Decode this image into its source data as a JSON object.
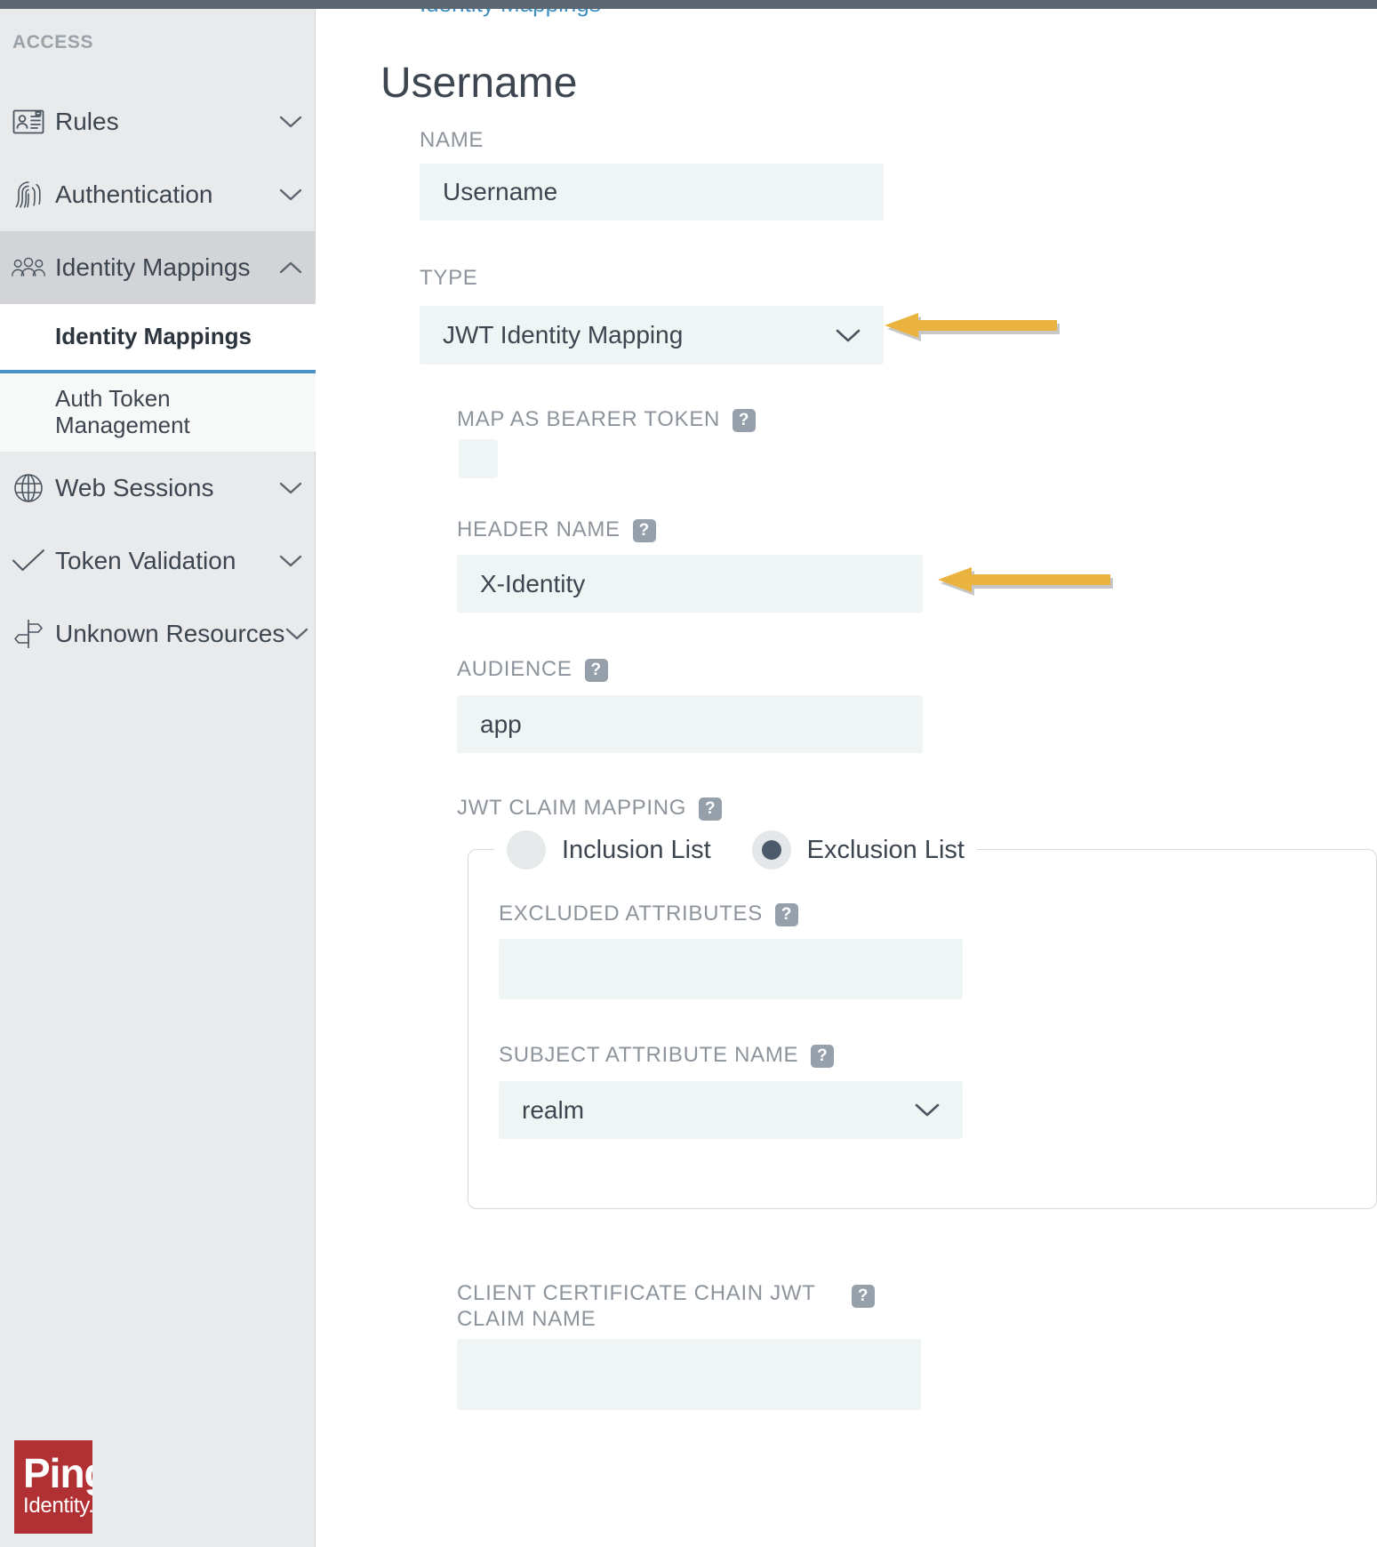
{
  "breadcrumb": {
    "text": "Identity Mappings"
  },
  "sidebar": {
    "section_title": "ACCESS",
    "items": [
      {
        "label": "Rules",
        "icon": "id-card-icon",
        "chevron": "chevron-down-icon",
        "expanded": false
      },
      {
        "label": "Authentication",
        "icon": "fingerprint-icon",
        "chevron": "chevron-down-icon",
        "expanded": false
      },
      {
        "label": "Identity Mappings",
        "icon": "users-group-icon",
        "chevron": "chevron-up-icon",
        "expanded": true
      },
      {
        "label": "Web Sessions",
        "icon": "globe-icon",
        "chevron": "chevron-down-icon",
        "expanded": false
      },
      {
        "label": "Token Validation",
        "icon": "check-icon",
        "chevron": "chevron-down-icon",
        "expanded": false
      },
      {
        "label": "Unknown Resources",
        "icon": "signpost-icon",
        "chevron": "chevron-down-icon",
        "expanded": false
      }
    ],
    "subitems": [
      {
        "label": "Identity Mappings",
        "active": true
      },
      {
        "label": "Auth Token Management",
        "active": false
      }
    ],
    "logo": {
      "line1": "Ping",
      "line2": "Identity."
    }
  },
  "main": {
    "page_title": "Username",
    "fields": {
      "name": {
        "label": "NAME",
        "value": "Username",
        "placeholder": ""
      },
      "type": {
        "label": "TYPE",
        "value": "JWT Identity Mapping",
        "chevron": "chevron-down-icon"
      },
      "map_as_bearer_token": {
        "label": "MAP AS BEARER TOKEN",
        "help": "?",
        "checked": false
      },
      "header_name": {
        "label": "HEADER NAME",
        "help": "?",
        "value": "X-Identity",
        "placeholder": ""
      },
      "audience": {
        "label": "AUDIENCE",
        "help": "?",
        "value": "app",
        "placeholder": ""
      },
      "jwt_claim_mapping": {
        "label": "JWT CLAIM MAPPING",
        "help": "?",
        "options": [
          {
            "label": "Inclusion List",
            "selected": false
          },
          {
            "label": "Exclusion List",
            "selected": true
          }
        ]
      },
      "excluded_attributes": {
        "label": "EXCLUDED ATTRIBUTES",
        "help": "?",
        "value": "",
        "placeholder": ""
      },
      "subject_attribute_name": {
        "label": "SUBJECT ATTRIBUTE NAME",
        "help": "?",
        "value": "realm",
        "chevron": "chevron-down-icon"
      },
      "client_cert_chain_claim_name": {
        "label": "CLIENT CERTIFICATE CHAIN JWT CLAIM NAME",
        "help": "?",
        "value": "",
        "placeholder": ""
      }
    }
  },
  "annotations": {
    "arrow_color": "#eab33f",
    "arrows": [
      {
        "name": "arrow-pointing-to-type-dropdown"
      },
      {
        "name": "arrow-pointing-to-header-name-field"
      }
    ]
  },
  "colors": {
    "sidebar_bg": "#e9eaec",
    "field_bg": "#eff4f4",
    "text": "#3d4650",
    "label": "#8d949c",
    "accent_blue": "#4a90c4",
    "brand_red": "#b13034",
    "arrow_yellow": "#eab33f"
  }
}
